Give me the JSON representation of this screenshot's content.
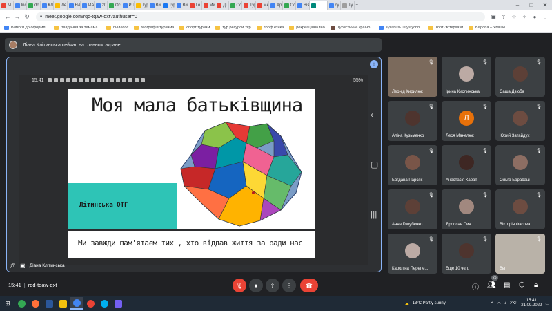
{
  "browser": {
    "tabs": [
      {
        "label": "M",
        "color": "#ea4335"
      },
      {
        "label": "Inc",
        "color": "#4285f4"
      },
      {
        "label": "do",
        "color": "#34a853"
      },
      {
        "label": "КЛ",
        "color": "#4285f4"
      },
      {
        "label": "Ле",
        "color": "#fbbc04"
      },
      {
        "label": "НА",
        "color": "#4285f4"
      },
      {
        "label": "ИА",
        "color": "#4285f4"
      },
      {
        "label": "20",
        "color": "#4285f4"
      },
      {
        "label": "Ос",
        "color": "#34a853"
      },
      {
        "label": "РП",
        "color": "#4285f4"
      },
      {
        "label": "Тур",
        "color": "#fbbc04"
      },
      {
        "label": "Ви",
        "color": "#4285f4"
      },
      {
        "label": "Тур",
        "color": "#1877f2"
      },
      {
        "label": "Ви",
        "color": "#4285f4"
      },
      {
        "label": "Го",
        "color": "#ea4335"
      },
      {
        "label": "Ми",
        "color": "#ea4335"
      },
      {
        "label": "Ді",
        "color": "#ea4335"
      },
      {
        "label": "Ос",
        "color": "#34a853"
      },
      {
        "label": "Тур",
        "color": "#ea4335"
      },
      {
        "label": "Ме",
        "color": "#ea4335"
      },
      {
        "label": "Ар",
        "color": "#4285f4"
      },
      {
        "label": "Ос",
        "color": "#34a853"
      },
      {
        "label": "Вія",
        "color": "#4285f4"
      },
      {
        "label": "",
        "color": "#00897b"
      },
      {
        "label": "су",
        "color": "#4285f4"
      },
      {
        "label": "Ту",
        "color": "#9e9e9e"
      }
    ],
    "url": "meet.google.com/rqd-tqaw-qxt?authuser=0",
    "bookmarks": [
      {
        "label": "Вимоги до оформл...",
        "type": "g"
      },
      {
        "label": "Завдання за темама...",
        "type": "y"
      },
      {
        "label": "пылесос",
        "type": "y"
      },
      {
        "label": "географія туризма",
        "type": "y"
      },
      {
        "label": "спорт туризм",
        "type": "y"
      },
      {
        "label": "тур ресурси Укр",
        "type": "y"
      },
      {
        "label": "проф етика",
        "type": "y"
      },
      {
        "label": "рекреаційна гео",
        "type": "y"
      },
      {
        "label": "Туристичне країно...",
        "type": "m"
      },
      {
        "label": "syllabus-Turystychn...",
        "type": "g"
      },
      {
        "label": "Торт Эстерхази",
        "type": "y"
      },
      {
        "label": "Європа – УМІТИ",
        "type": "y"
      }
    ]
  },
  "meet": {
    "presenting_text": "Діана Клітинська сейчас на главном экране",
    "presenter_label": "Діана Клітинська",
    "phone_time": "15:41",
    "phone_battery": "55%",
    "slide": {
      "title": "Моя мала батьківщина",
      "region_label": "Літинська ОТГ",
      "second_slide_text": "Ми завжди пам'ятаєм тих , хто віддав життя за ради нас"
    },
    "participants": [
      {
        "name": "Леонід Кирилюк",
        "initial": ""
      },
      {
        "name": "Ірина Кислинська",
        "initial": ""
      },
      {
        "name": "Саша Дзюба",
        "initial": ""
      },
      {
        "name": "Аліна Кузьменко",
        "initial": ""
      },
      {
        "name": "Леся Манелюк",
        "initial": "Л"
      },
      {
        "name": "Юрий Затайдух",
        "initial": ""
      },
      {
        "name": "Богдана Парсяк",
        "initial": ""
      },
      {
        "name": "Анастасія Карая",
        "initial": ""
      },
      {
        "name": "Ольга Барабаш",
        "initial": ""
      },
      {
        "name": "Анна Голубенко",
        "initial": ""
      },
      {
        "name": "Ярослав Сич",
        "initial": ""
      },
      {
        "name": "Вікторія Фасова",
        "initial": ""
      },
      {
        "name": "Кароліна Перепе...",
        "initial": ""
      },
      {
        "name": "Еще 10 чел.",
        "initial": ""
      },
      {
        "name": "Вы",
        "initial": ""
      }
    ],
    "meeting_time": "15:41",
    "meeting_code": "rqd-tqaw-qxt",
    "participant_count": "25"
  },
  "taskbar": {
    "weather": "13°C  Partly sunny",
    "language": "УКР",
    "time": "15:41",
    "date": "21.09.2022"
  }
}
